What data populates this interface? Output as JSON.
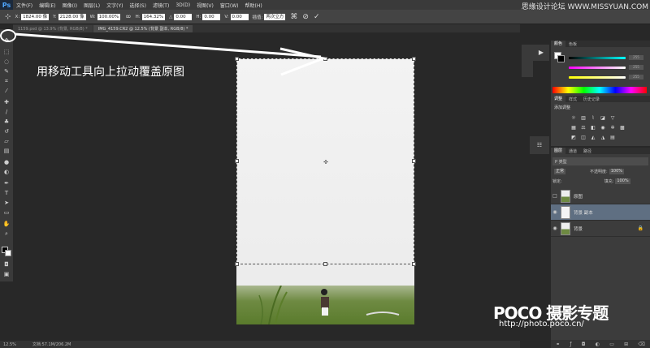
{
  "watermark_top": "思缘设计论坛  WWW.MISSYUAN.COM",
  "menu": [
    "文件(F)",
    "编辑(E)",
    "图像(I)",
    "图层(L)",
    "文字(Y)",
    "选择(S)",
    "滤镜(T)",
    "3D(D)",
    "视图(V)",
    "窗口(W)",
    "帮助(H)"
  ],
  "options": {
    "x_label": "X:",
    "x_value": "1824.00 像",
    "y_label": "Y:",
    "y_value": "2128.00 像",
    "w_label": "W:",
    "w_value": "100.00%",
    "h_label": "H:",
    "h_value": "164.32%",
    "angle_label": "△",
    "angle_value": "0.00",
    "hskew_label": "H:",
    "hskew_value": "0.00",
    "vskew_label": "V:",
    "vskew_value": "0.00",
    "interp_label": "插值:",
    "interp_value": "两次立方"
  },
  "tabs": [
    "1159.psd @ 13.9% (背景, RGB/8) *",
    "IMG_4159.CR2 @ 12.5% (背景 副本, RGB/8) *"
  ],
  "instruction": "用移动工具向上拉动覆盖原图",
  "color_panel": {
    "tab1": "颜色",
    "tab2": "色板",
    "v1": "255",
    "v2": "255",
    "v3": "255"
  },
  "adj_panel": {
    "tab1": "调整",
    "tab2": "样式",
    "tab3": "历史记录",
    "title": "添加调整"
  },
  "layers_panel": {
    "tab1": "图层",
    "tab2": "通道",
    "tab3": "路径",
    "kind": "P 类型",
    "blend": "正常",
    "opacity_label": "不透明度:",
    "opacity_value": "100%",
    "lock_label": "锁定:",
    "fill_label": "填充:",
    "fill_value": "100%",
    "layers": [
      {
        "name": "原图"
      },
      {
        "name": "背景 副本"
      },
      {
        "name": "背景"
      }
    ]
  },
  "status": {
    "zoom": "12.5%",
    "doc": "文档:57.1M/206.2M"
  },
  "poco": {
    "logo": "POCO 摄影专题",
    "url": "http://photo.poco.cn/"
  }
}
